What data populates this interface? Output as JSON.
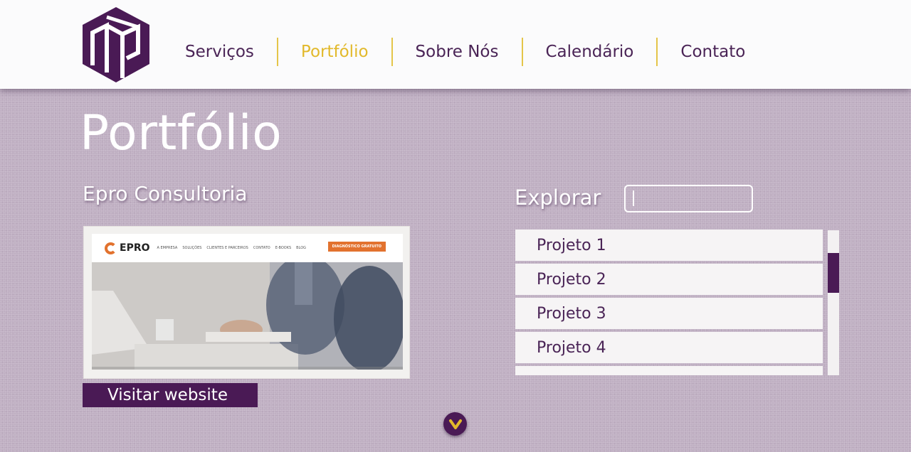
{
  "header": {
    "logo_icon": "cube-monogram-logo",
    "nav": [
      {
        "label": "Serviços",
        "active": false
      },
      {
        "label": "Portfólio",
        "active": true
      },
      {
        "label": "Sobre Nós",
        "active": false
      },
      {
        "label": "Calendário",
        "active": false
      },
      {
        "label": "Contato",
        "active": false
      }
    ]
  },
  "main": {
    "title": "Portfólio",
    "project": {
      "name": "Epro Consultoria",
      "visit_label": "Visitar website",
      "preview": {
        "brand": "EPRO",
        "links": [
          "A EMPRESA",
          "SOLUÇÕES",
          "CLIENTES E PARCEIROS",
          "CONTATO",
          "E-BOOKS",
          "BLOG"
        ],
        "cta": "DIAGNÓSTICO GRATUITO"
      }
    },
    "explore": {
      "label": "Explorar",
      "input_value": "",
      "items": [
        "Projeto 1",
        "Projeto 2",
        "Projeto 3",
        "Projeto 4"
      ]
    },
    "scroll_down_icon": "chevron-down-icon"
  },
  "colors": {
    "brand_purple": "#4a1a55",
    "accent_yellow": "#e2b92b",
    "background": "#bfafc2"
  }
}
